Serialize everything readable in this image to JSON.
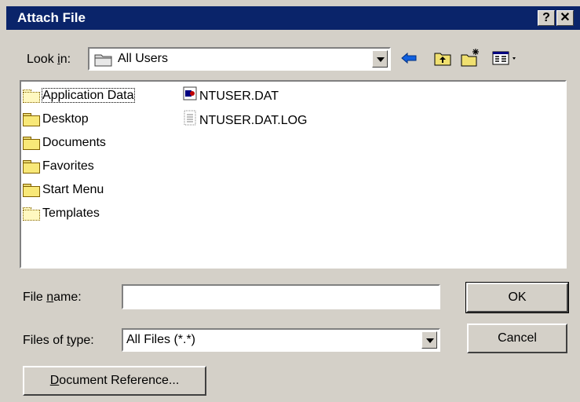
{
  "window": {
    "title": "Attach File",
    "help_glyph": "?",
    "close_glyph": "✕"
  },
  "lookin": {
    "label": "Look in:",
    "value": "All Users",
    "folder_icon": "folder-icon"
  },
  "toolbar": {
    "back_icon": "back-arrow-icon",
    "up_icon": "up-folder-icon",
    "new_folder_icon": "new-folder-icon",
    "view_icon": "view-menu-icon"
  },
  "files": {
    "col1": [
      "Application Data",
      "Desktop",
      "Documents",
      "Favorites",
      "Start Menu",
      "Templates"
    ],
    "col2": [
      "NTUSER.DAT",
      "NTUSER.DAT.LOG"
    ]
  },
  "form": {
    "filename_label": "File name:",
    "filename_value": "",
    "filetype_label": "Files of type:",
    "filetype_value": "All Files (*.*)"
  },
  "buttons": {
    "ok": "OK",
    "cancel": "Cancel",
    "docref": "Document Reference..."
  }
}
